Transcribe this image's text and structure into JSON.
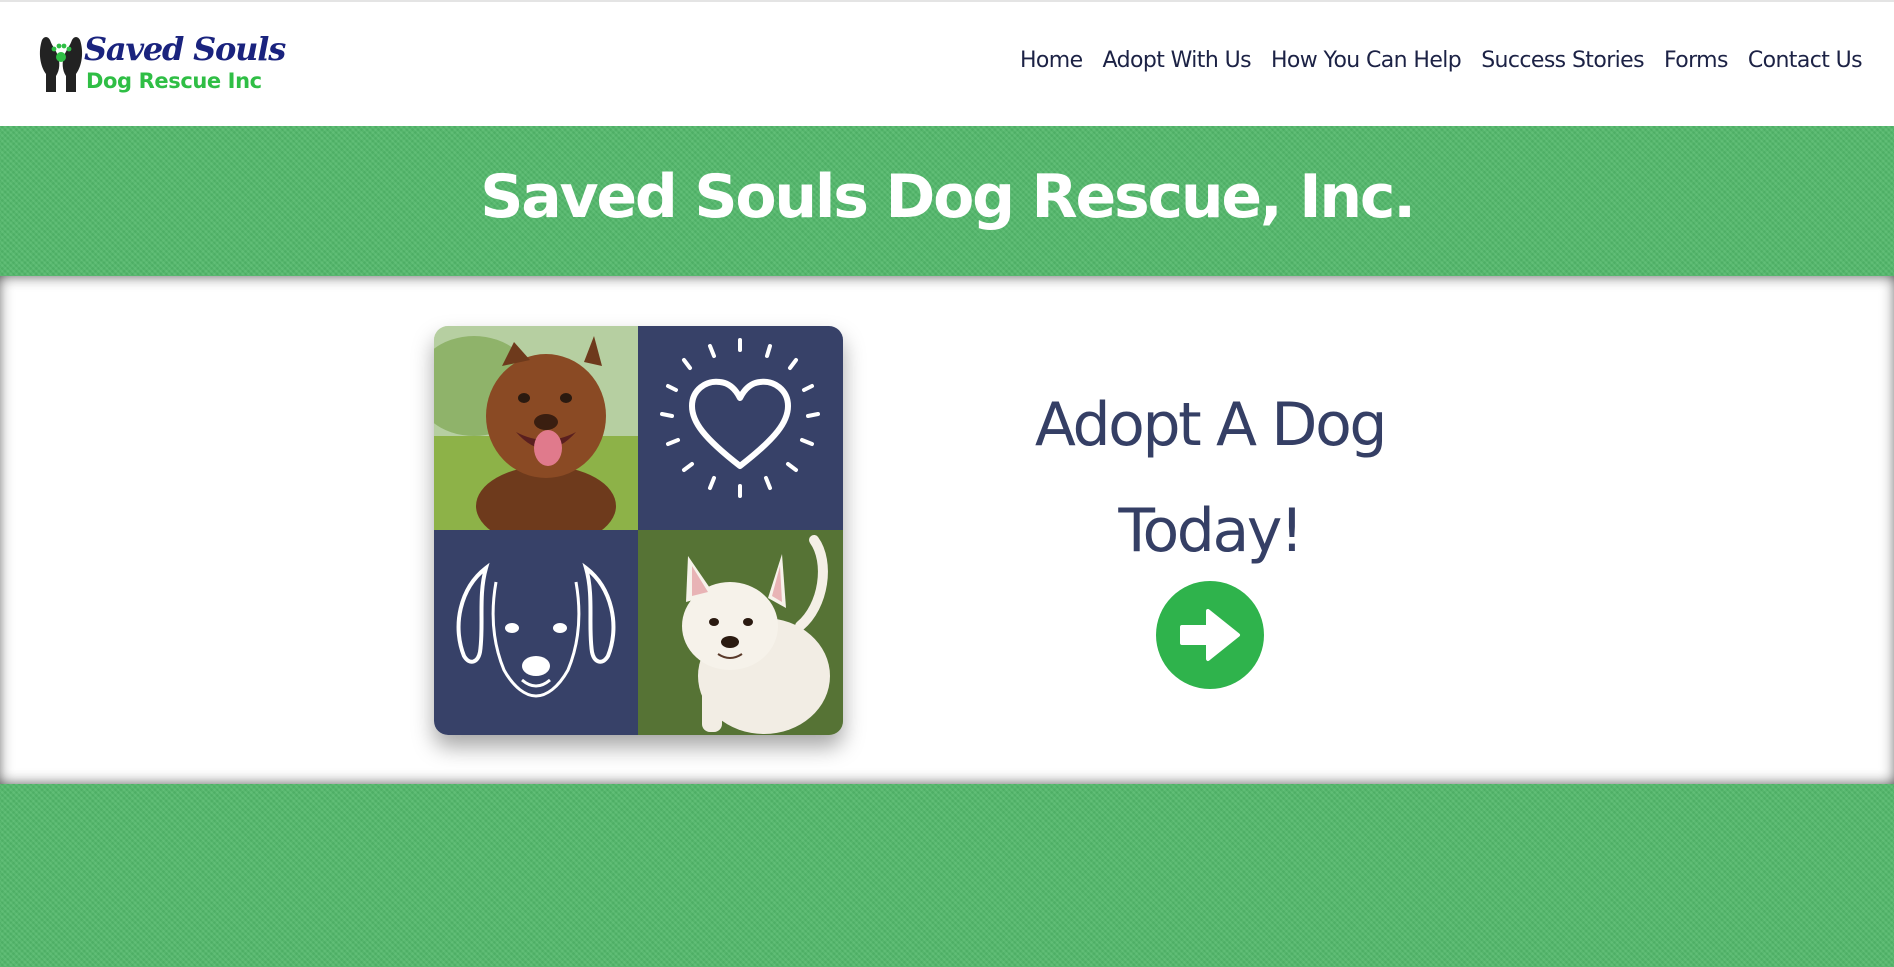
{
  "brand": {
    "logo_line1": "Saved Souls",
    "logo_line2": "Dog Rescue Inc",
    "logo_icon": "hands-paw-icon",
    "colors": {
      "navy": "#1a237e",
      "green": "#2fbe45"
    }
  },
  "nav": {
    "items": [
      {
        "label": "Home"
      },
      {
        "label": "Adopt With Us"
      },
      {
        "label": "How You Can Help"
      },
      {
        "label": "Success Stories"
      },
      {
        "label": "Forms"
      },
      {
        "label": "Contact Us"
      }
    ]
  },
  "hero": {
    "title": "Saved Souls Dog Rescue, Inc.",
    "band_color": "#52b86a"
  },
  "adopt": {
    "line1": "Adopt A Dog",
    "line2": "Today!",
    "text_color": "#353f65",
    "button_icon": "arrow-right-icon",
    "button_color": "#2fb34c"
  },
  "collage": {
    "tiles": [
      "brown-dog-photo",
      "heart-icon",
      "dog-face-icon",
      "white-dog-photo"
    ],
    "tile_color": "#374168"
  }
}
